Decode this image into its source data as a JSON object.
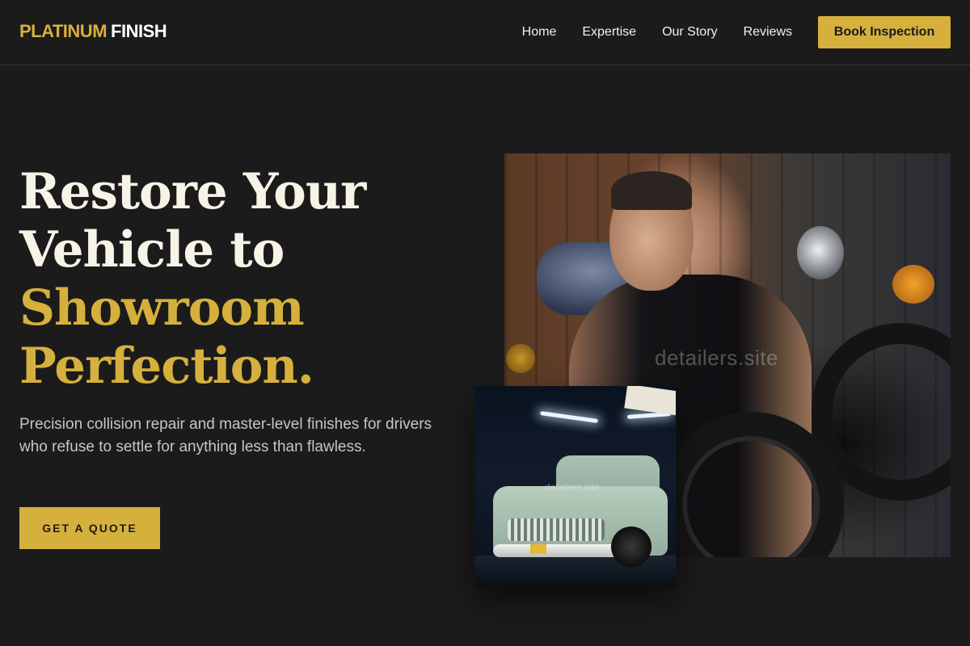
{
  "header": {
    "logo_primary": "PLATINUM",
    "logo_secondary": "FINISH",
    "nav": [
      "Home",
      "Expertise",
      "Our Story",
      "Reviews"
    ],
    "cta": "Book Inspection"
  },
  "hero": {
    "title_line1": "Restore Your",
    "title_line2": "Vehicle to",
    "title_line3": "Showroom",
    "title_line4": "Perfection.",
    "subtitle": "Precision collision repair and master-level finishes for drivers who refuse to settle for anything less than flawless.",
    "cta": "GET A QUOTE"
  },
  "images": {
    "main_watermark": "detailers.site",
    "small_watermark": "detailers.site"
  },
  "colors": {
    "accent": "#d6b03c",
    "background": "#1b1b1b"
  }
}
